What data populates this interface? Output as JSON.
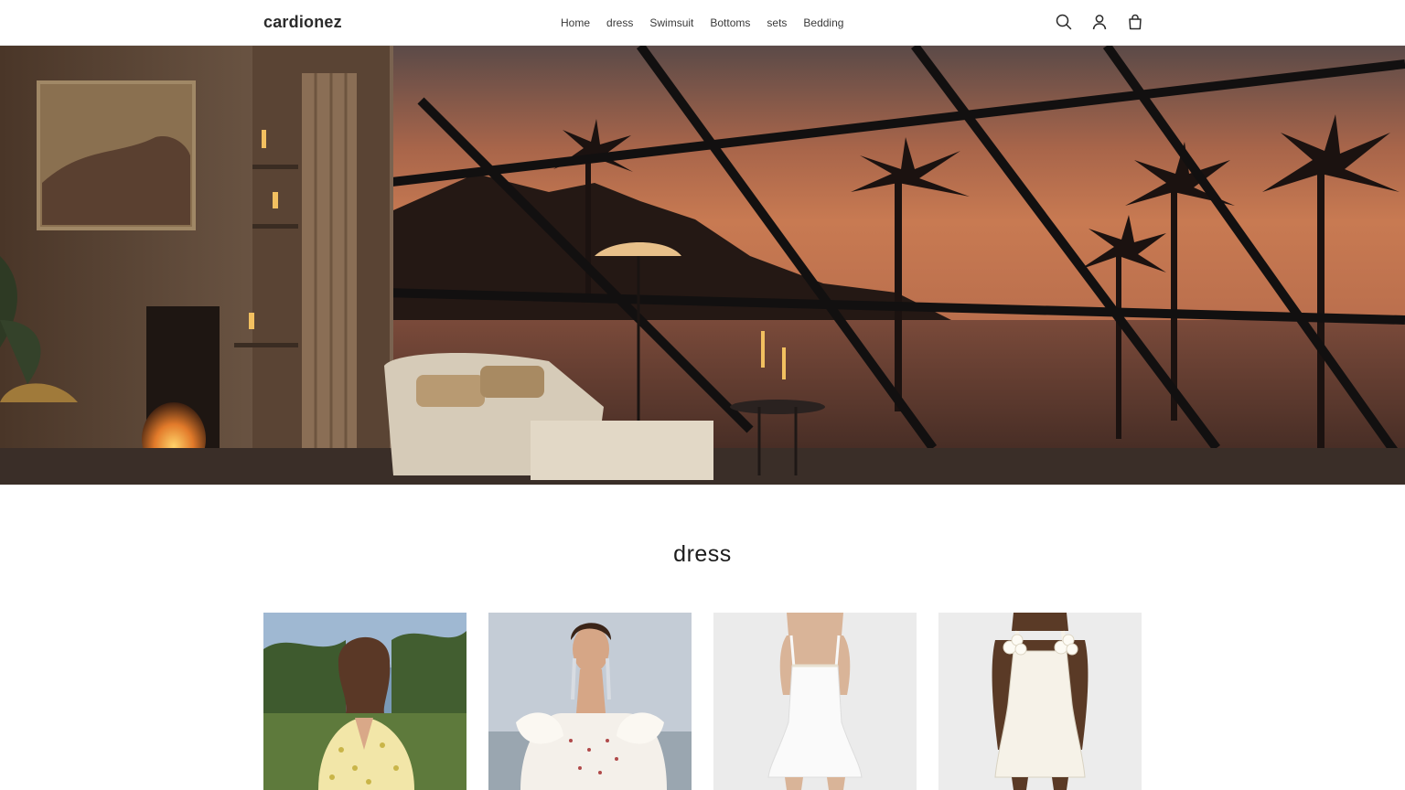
{
  "header": {
    "logo": "cardionez",
    "nav": [
      "Home",
      "dress",
      "Swimsuit",
      "Bottoms",
      "sets",
      "Bedding"
    ],
    "icons": [
      "search-icon",
      "account-icon",
      "cart-icon"
    ]
  },
  "collection": {
    "title": "dress",
    "products": [
      {
        "image": "yellow-floral-dress-photo"
      },
      {
        "image": "white-ruffle-off-shoulder-dress-photo"
      },
      {
        "image": "white-mini-dress-photo"
      },
      {
        "image": "white-flower-strap-dress-photo"
      }
    ]
  },
  "colors": {
    "sunset_sky": "#c0714a",
    "text": "#121212",
    "background": "#ffffff"
  }
}
